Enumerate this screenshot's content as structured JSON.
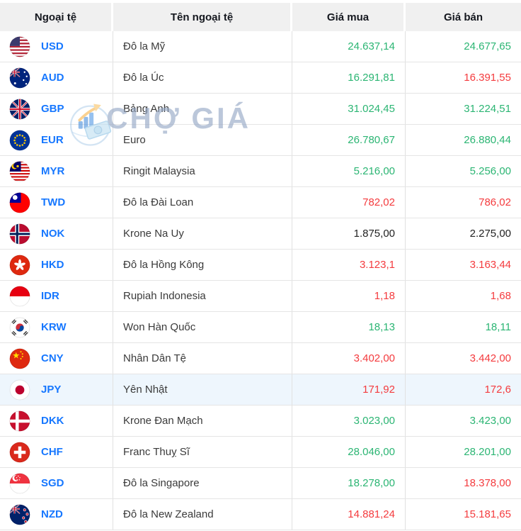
{
  "header": {
    "columns": [
      {
        "label": "Ngoại tệ"
      },
      {
        "label": "Tên ngoại tệ"
      },
      {
        "label": "Giá mua"
      },
      {
        "label": "Giá bán"
      }
    ]
  },
  "watermark": {
    "text": "CHỢ GIÁ"
  },
  "colors": {
    "positive": "#2bb573",
    "negative": "#f43b3e",
    "neutral": "#222222",
    "code": "#1677ff",
    "header_bg": "#f0f0f0",
    "highlight_row": "#eef6fd"
  },
  "rows": [
    {
      "code": "USD",
      "flag_icon": "usd-flag-icon",
      "name": "Đô la Mỹ",
      "buy": {
        "value": "24.637,14",
        "trend": "up"
      },
      "sell": {
        "value": "24.677,65",
        "trend": "up"
      },
      "highlighted": false
    },
    {
      "code": "AUD",
      "flag_icon": "aud-flag-icon",
      "name": "Đô la Úc",
      "buy": {
        "value": "16.291,81",
        "trend": "up"
      },
      "sell": {
        "value": "16.391,55",
        "trend": "down"
      },
      "highlighted": false
    },
    {
      "code": "GBP",
      "flag_icon": "gbp-flag-icon",
      "name": "Bảng Anh",
      "buy": {
        "value": "31.024,45",
        "trend": "up"
      },
      "sell": {
        "value": "31.224,51",
        "trend": "up"
      },
      "highlighted": false
    },
    {
      "code": "EUR",
      "flag_icon": "eur-flag-icon",
      "name": "Euro",
      "buy": {
        "value": "26.780,67",
        "trend": "up"
      },
      "sell": {
        "value": "26.880,44",
        "trend": "up"
      },
      "highlighted": false
    },
    {
      "code": "MYR",
      "flag_icon": "myr-flag-icon",
      "name": "Ringit Malaysia",
      "buy": {
        "value": "5.216,00",
        "trend": "up"
      },
      "sell": {
        "value": "5.256,00",
        "trend": "up"
      },
      "highlighted": false
    },
    {
      "code": "TWD",
      "flag_icon": "twd-flag-icon",
      "name": "Đô la Đài Loan",
      "buy": {
        "value": "782,02",
        "trend": "down"
      },
      "sell": {
        "value": "786,02",
        "trend": "down"
      },
      "highlighted": false
    },
    {
      "code": "NOK",
      "flag_icon": "nok-flag-icon",
      "name": "Krone Na Uy",
      "buy": {
        "value": "1.875,00",
        "trend": "flat"
      },
      "sell": {
        "value": "2.275,00",
        "trend": "flat"
      },
      "highlighted": false
    },
    {
      "code": "HKD",
      "flag_icon": "hkd-flag-icon",
      "name": "Đô la Hồng Kông",
      "buy": {
        "value": "3.123,1",
        "trend": "down"
      },
      "sell": {
        "value": "3.163,44",
        "trend": "down"
      },
      "highlighted": false
    },
    {
      "code": "IDR",
      "flag_icon": "idr-flag-icon",
      "name": "Rupiah Indonesia",
      "buy": {
        "value": "1,18",
        "trend": "down"
      },
      "sell": {
        "value": "1,68",
        "trend": "down"
      },
      "highlighted": false
    },
    {
      "code": "KRW",
      "flag_icon": "krw-flag-icon",
      "name": "Won Hàn Quốc",
      "buy": {
        "value": "18,13",
        "trend": "up"
      },
      "sell": {
        "value": "18,11",
        "trend": "up"
      },
      "highlighted": false
    },
    {
      "code": "CNY",
      "flag_icon": "cny-flag-icon",
      "name": "Nhân Dân Tệ",
      "buy": {
        "value": "3.402,00",
        "trend": "down"
      },
      "sell": {
        "value": "3.442,00",
        "trend": "down"
      },
      "highlighted": false
    },
    {
      "code": "JPY",
      "flag_icon": "jpy-flag-icon",
      "name": "Yên Nhật",
      "buy": {
        "value": "171,92",
        "trend": "down"
      },
      "sell": {
        "value": "172,6",
        "trend": "down"
      },
      "highlighted": true
    },
    {
      "code": "DKK",
      "flag_icon": "dkk-flag-icon",
      "name": "Krone Đan Mạch",
      "buy": {
        "value": "3.023,00",
        "trend": "up"
      },
      "sell": {
        "value": "3.423,00",
        "trend": "up"
      },
      "highlighted": false
    },
    {
      "code": "CHF",
      "flag_icon": "chf-flag-icon",
      "name": "Franc Thuỵ Sĩ",
      "buy": {
        "value": "28.046,00",
        "trend": "up"
      },
      "sell": {
        "value": "28.201,00",
        "trend": "up"
      },
      "highlighted": false
    },
    {
      "code": "SGD",
      "flag_icon": "sgd-flag-icon",
      "name": "Đô la Singapore",
      "buy": {
        "value": "18.278,00",
        "trend": "up"
      },
      "sell": {
        "value": "18.378,00",
        "trend": "down"
      },
      "highlighted": false
    },
    {
      "code": "NZD",
      "flag_icon": "nzd-flag-icon",
      "name": "Đô la New Zealand",
      "buy": {
        "value": "14.881,24",
        "trend": "down"
      },
      "sell": {
        "value": "15.181,65",
        "trend": "down"
      },
      "highlighted": false
    }
  ]
}
